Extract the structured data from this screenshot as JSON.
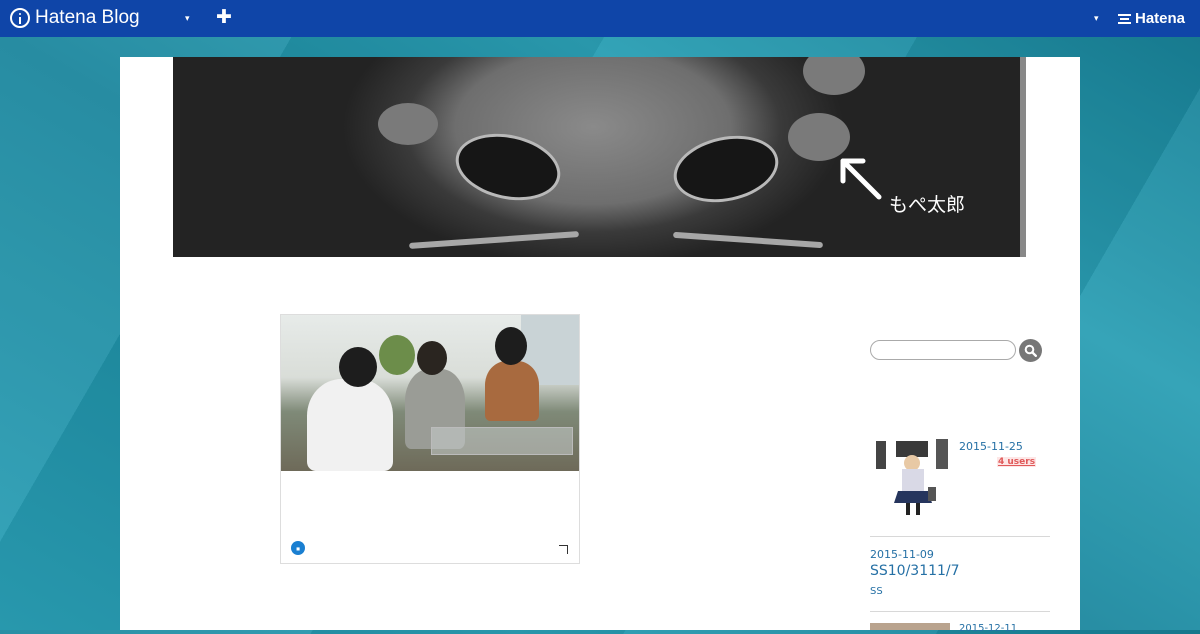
{
  "topbar": {
    "brand_name": "Hatena Blog",
    "hatena_label": "Hatena",
    "menu_caret": "▾",
    "add_symbol": "✚",
    "right_caret": "▾"
  },
  "header": {
    "caption": "もぺ太郎"
  },
  "sidebar": {
    "search_placeholder": "",
    "entries": [
      {
        "date": "2015-11-25",
        "badge": "4 users"
      },
      {
        "date": "2015-11-09",
        "title": "SS10/3111/7",
        "category": "SS"
      },
      {
        "date": "2015-12-11"
      }
    ]
  },
  "colors": {
    "topbar": "#0f45a8",
    "link": "#2570a5",
    "badge": "#e05a5a"
  }
}
